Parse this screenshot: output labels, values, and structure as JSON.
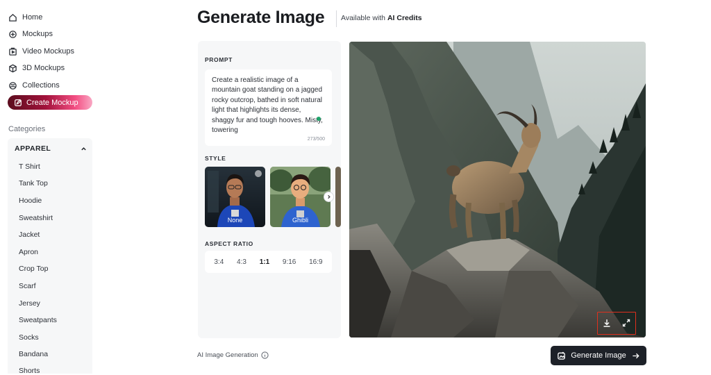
{
  "sidebar": {
    "nav": [
      {
        "label": "Home",
        "icon": "home-icon"
      },
      {
        "label": "Mockups",
        "icon": "mockups-icon"
      },
      {
        "label": "Video Mockups",
        "icon": "video-mockups-icon"
      },
      {
        "label": "3D Mockups",
        "icon": "cube-icon"
      },
      {
        "label": "Collections",
        "icon": "collections-icon"
      }
    ],
    "create_label": "Create Mockup",
    "categories_label": "Categories",
    "category_group": "APPAREL",
    "category_items": [
      "T Shirt",
      "Tank Top",
      "Hoodie",
      "Sweatshirt",
      "Jacket",
      "Apron",
      "Crop Top",
      "Scarf",
      "Jersey",
      "Sweatpants",
      "Socks",
      "Bandana",
      "Shorts"
    ]
  },
  "header": {
    "title": "Generate Image",
    "availability_prefix": "Available with ",
    "availability_strong": "AI Credits"
  },
  "prompt": {
    "label": "PROMPT",
    "text": "Create a realistic image of a mountain goat standing on a jagged rocky outcrop, bathed in soft natural light that highlights its dense, shaggy fur and tough hooves. Misty, towering",
    "count": "273/500"
  },
  "style": {
    "label": "STYLE",
    "options": [
      {
        "label": "None",
        "selected": true
      },
      {
        "label": "Ghibli",
        "selected": false
      }
    ]
  },
  "aspect": {
    "label": "ASPECT RATIO",
    "options": [
      "3:4",
      "4:3",
      "1:1",
      "9:16",
      "16:9"
    ],
    "selected": "1:1"
  },
  "footer": {
    "ai_label": "AI Image Generation",
    "generate_label": "Generate Image"
  },
  "colors": {
    "accent_gradient_start": "#5b0d1e",
    "accent_gradient_end": "#f34f83",
    "button_dark": "#1d2128",
    "highlight_red": "#e0301e"
  }
}
